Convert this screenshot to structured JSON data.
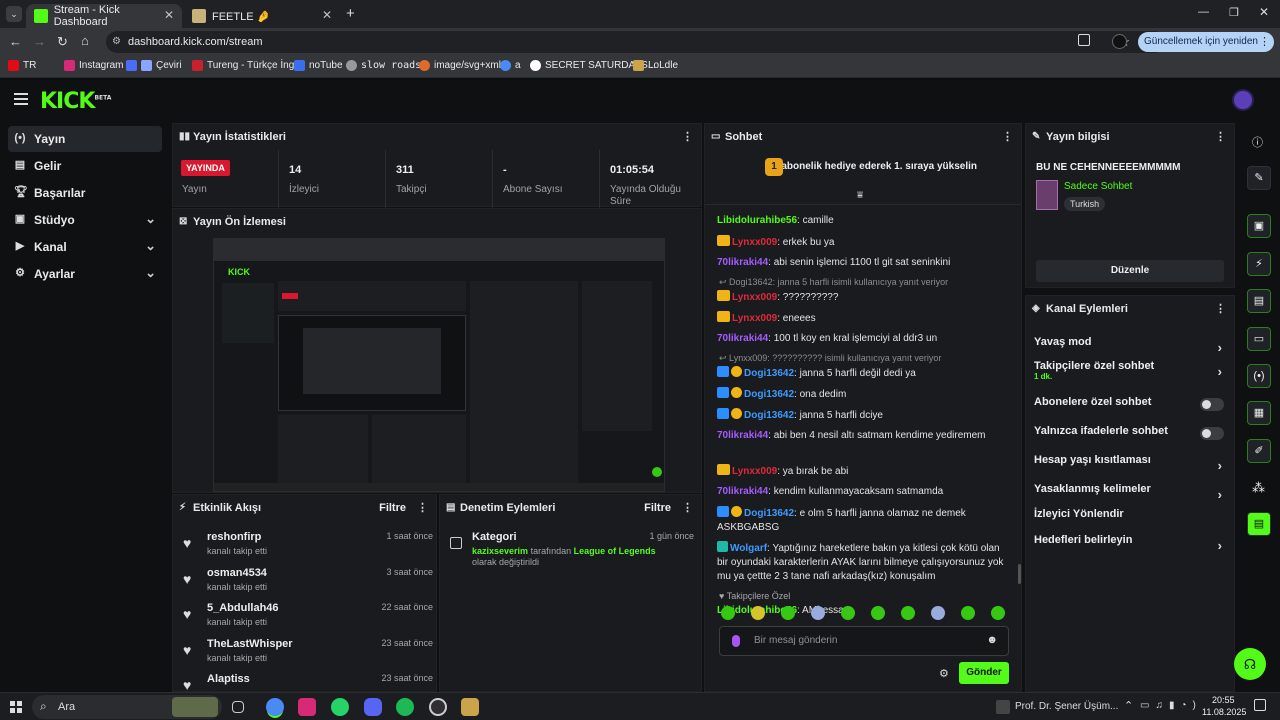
{
  "browser": {
    "tabs": [
      {
        "label": "Stream - Kick Dashboard",
        "active": true
      },
      {
        "label": "FEETLE 🤌",
        "active": false
      }
    ],
    "url": "dashboard.kick.com/stream",
    "update_label": "Güncellemek için yeniden başlat",
    "bookmarks": [
      "TR",
      "Instagram",
      "Çeviri",
      "Tureng - Türkçe İngi...",
      "noTube",
      "slow roads",
      "image/svg+xml",
      "a",
      "SECRET SATURDAYS...",
      "LoLdle"
    ]
  },
  "app": {
    "logo": "KICK",
    "logo_sup": "BETA",
    "accent": "#53fc18",
    "nav": [
      {
        "label": "Yayın",
        "icon": "broadcast-icon",
        "active": true,
        "chevron": false
      },
      {
        "label": "Gelir",
        "icon": "revenue-icon",
        "active": false,
        "chevron": false
      },
      {
        "label": "Başarılar",
        "icon": "trophy-icon",
        "active": false,
        "chevron": false
      },
      {
        "label": "Stüdyo",
        "icon": "studio-icon",
        "active": false,
        "chevron": true
      },
      {
        "label": "Kanal",
        "icon": "channel-icon",
        "active": false,
        "chevron": true
      },
      {
        "label": "Ayarlar",
        "icon": "gear-icon",
        "active": false,
        "chevron": true
      }
    ]
  },
  "stats": {
    "title": "Yayın İstatistikleri",
    "live_badge": "YAYINDA",
    "live_label": "Yayın",
    "items": [
      {
        "value": "14",
        "label": "İzleyici"
      },
      {
        "value": "311",
        "label": "Takipçi"
      },
      {
        "value": "-",
        "label": "Abone Sayısı"
      },
      {
        "value": "01:05:54",
        "label": "Yayında Olduğu Süre"
      }
    ]
  },
  "preview": {
    "title": "Yayın Ön İzlemesi"
  },
  "events": {
    "title": "Etkinlik Akışı",
    "filter": "Filtre",
    "items": [
      {
        "name": "reshonfirp",
        "sub": "kanalı takip etti",
        "time": "1 saat önce"
      },
      {
        "name": "osman4534",
        "sub": "kanalı takip etti",
        "time": "3 saat önce"
      },
      {
        "name": "5_Abdullah46",
        "sub": "kanalı takip etti",
        "time": "22 saat önce"
      },
      {
        "name": "TheLastWhisper",
        "sub": "kanalı takip etti",
        "time": "23 saat önce"
      },
      {
        "name": "Alaptiss",
        "sub": "",
        "time": "23 saat önce"
      }
    ]
  },
  "moderation": {
    "title": "Denetim Eylemleri",
    "filter": "Filtre",
    "item": {
      "title": "Kategori",
      "time": "1 gün önce",
      "user": "kazixseverim",
      "mid": "tarafından",
      "game": "League of Legends",
      "tail": "olarak değiştirildi"
    }
  },
  "chat": {
    "title": "Sohbet",
    "pinned": "1 abonelik hediye ederek 1. sıraya yükselin",
    "messages": [
      {
        "user": "Libidolurahibe56",
        "color": "green",
        "badges": [],
        "text": "camille"
      },
      {
        "user": "Lynxx009",
        "color": "red",
        "badges": [
          "crown"
        ],
        "text": "erkek bu ya"
      },
      {
        "user": "70likraki44",
        "color": "purple",
        "badges": [],
        "text": "abi senin işlemci 1100 tl git sat seninkini"
      },
      {
        "reply": "Dogi13642: janna 5 harfli isimli kullanıcıya yanıt veriyor",
        "user": "Lynxx009",
        "color": "red",
        "badges": [
          "crown"
        ],
        "text": "??????????"
      },
      {
        "user": "Lynxx009",
        "color": "red",
        "badges": [
          "crown"
        ],
        "text": "eneees"
      },
      {
        "user": "70likraki44",
        "color": "purple",
        "badges": [],
        "text": "100 tl koy en kral işlemciyi al ddr3 un"
      },
      {
        "reply": "Lynxx009: ?????????? isimli kullanıcıya yanıt veriyor",
        "user": "Dogi13642",
        "color": "blue",
        "badges": [
          "mod",
          "sub"
        ],
        "text": "janna 5 harfli değil dedi ya"
      },
      {
        "user": "Dogi13642",
        "color": "blue",
        "badges": [
          "mod",
          "sub"
        ],
        "text": "ona dedim"
      },
      {
        "user": "Dogi13642",
        "color": "blue",
        "badges": [
          "mod",
          "sub"
        ],
        "text": "janna 5 harfli dciye"
      },
      {
        "user": "70likraki44",
        "color": "purple",
        "badges": [],
        "text": "abi ben 4 nesil altı satmam kendime yediremem"
      },
      {
        "user": "Lynxx009",
        "color": "red",
        "badges": [
          "crown"
        ],
        "text": "ya bırak be abi"
      },
      {
        "user": "70likraki44",
        "color": "purple",
        "badges": [],
        "text": "kendim kullanmayacaksam satmamda"
      },
      {
        "user": "Dogi13642",
        "color": "blue",
        "badges": [
          "mod",
          "sub"
        ],
        "text": "e olm 5 harfli janna olamaz ne demek ASKBGABSG"
      },
      {
        "user": "Wolgarf",
        "color": "blue",
        "badges": [
          "vip"
        ],
        "text": "Yaptığınız hareketlere bakın ya kitlesi çok kötü olan bir oyundaki karakterlerin AYAK larını bilmeye çalışıyorsunuz yok mu ya çettte 2 3 tane nafi arkadaş(kız) konuşalım"
      },
      {
        "user": "Libidolurahibe56",
        "color": "green",
        "badges": [],
        "text": "AMbessa"
      }
    ],
    "emote_label": "Takipçilere Özel",
    "input_placeholder": "Bir mesaj gönderin",
    "send": "Gönder"
  },
  "info": {
    "title": "Yayın bilgisi",
    "stream_title": "BU NE CEHENNEEEEMMMMM",
    "category": "Sadece Sohbet",
    "tag": "Turkish",
    "edit": "Düzenle"
  },
  "actions": {
    "title": "Kanal Eylemleri",
    "items": [
      {
        "label": "Yavaş mod",
        "sub": "",
        "kind": "arrow"
      },
      {
        "label": "Takipçilere özel sohbet",
        "sub": "1 dk.",
        "kind": "arrow"
      },
      {
        "label": "Abonelere özel sohbet",
        "sub": "",
        "kind": "toggle"
      },
      {
        "label": "Yalnızca ifadelerle sohbet",
        "sub": "",
        "kind": "toggle"
      },
      {
        "label": "Hesap yaşı kısıtlaması",
        "sub": "",
        "kind": "arrow"
      },
      {
        "label": "Yasaklanmış kelimeler",
        "sub": "",
        "kind": "arrow"
      },
      {
        "label": "İzleyici Yönlendir",
        "sub": "",
        "kind": "none"
      },
      {
        "label": "Hedefleri belirleyin",
        "sub": "",
        "kind": "arrow"
      }
    ]
  },
  "taskbar": {
    "search": "Ara",
    "tray_app": "Prof. Dr. Şener Üşüm...",
    "time": "20:55",
    "date": "11.08.2025"
  }
}
